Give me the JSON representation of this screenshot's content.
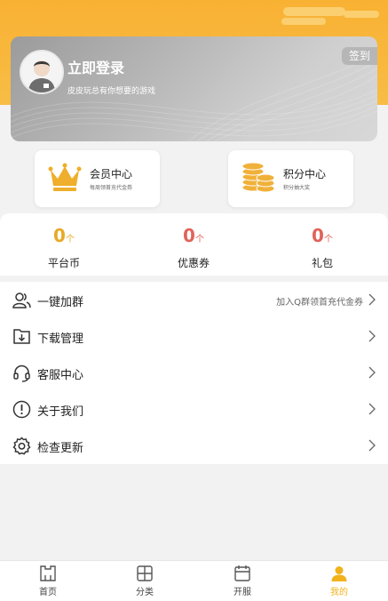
{
  "header": {
    "login_title": "立即登录",
    "login_subtitle": "皮皮玩总有你想要的游戏",
    "signin_label": "签到"
  },
  "quick_cards": {
    "member": {
      "title": "会员中心",
      "subtitle": "每周领首充代金券"
    },
    "points": {
      "title": "积分中心",
      "subtitle": "积分抽大奖"
    }
  },
  "stats": [
    {
      "value": "0",
      "arrow": "个",
      "label": "平台币"
    },
    {
      "value": "0",
      "arrow": "个",
      "label": "优惠券"
    },
    {
      "value": "0",
      "arrow": "个",
      "label": "礼包"
    }
  ],
  "menu": [
    {
      "label": "一键加群",
      "right_text": "加入Q群领首充代金券",
      "icon": "group-icon"
    },
    {
      "label": "下载管理",
      "right_text": "",
      "icon": "download-icon"
    },
    {
      "label": "客服中心",
      "right_text": "",
      "icon": "headset-icon"
    },
    {
      "label": "关于我们",
      "right_text": "",
      "icon": "info-icon"
    },
    {
      "label": "检查更新",
      "right_text": "",
      "icon": "gear-icon"
    }
  ],
  "tabbar": [
    {
      "label": "首页",
      "icon": "home-icon",
      "active": false
    },
    {
      "label": "分类",
      "icon": "category-icon",
      "active": false
    },
    {
      "label": "开服",
      "icon": "calendar-icon",
      "active": false
    },
    {
      "label": "我的",
      "icon": "user-icon",
      "active": true
    }
  ],
  "colors": {
    "brand": "#f9b133",
    "stat_gold": "#e9a825",
    "stat_red": "#e0635a",
    "tab_active": "#f1b21c"
  }
}
